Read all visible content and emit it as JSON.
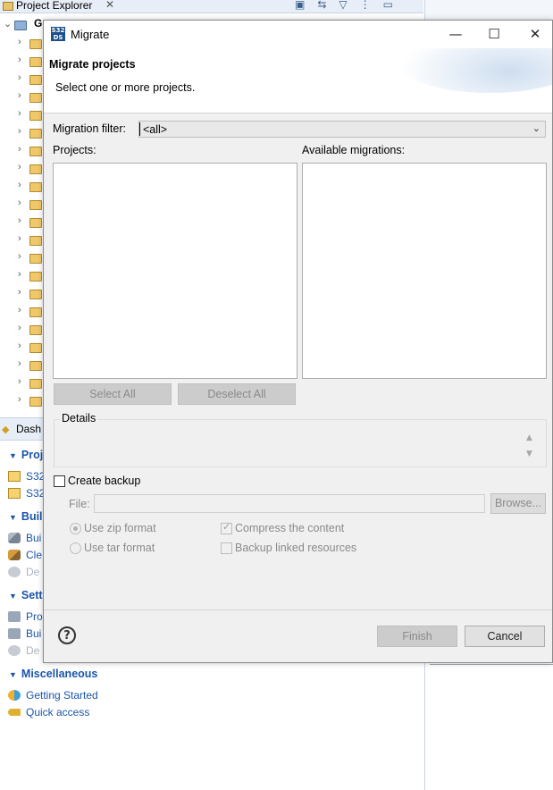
{
  "background": {
    "project_explorer": {
      "title": "Project Explorer",
      "close_glyph": "✕",
      "tool_icons": [
        "collapse-all-icon",
        "link-editor-icon",
        "filter-icon",
        "view-menu-icon",
        "minimize-icon"
      ],
      "root_label": "G",
      "folder_rows": 21
    },
    "dashboard": {
      "tab_label": "Dash",
      "sections": [
        {
          "label": "Proj",
          "items": [
            {
              "label": "S32",
              "icon": "new-project-icon",
              "disabled": false
            },
            {
              "label": "S32",
              "icon": "import-project-icon",
              "disabled": false
            }
          ]
        },
        {
          "label": "Buil",
          "items": [
            {
              "label": "Bui",
              "icon": "build-icon",
              "disabled": false
            },
            {
              "label": "Cle",
              "icon": "clean-icon",
              "disabled": false
            },
            {
              "label": "De",
              "icon": "debug-icon",
              "disabled": true
            }
          ]
        },
        {
          "label": "Sett",
          "items": [
            {
              "label": "Pro",
              "icon": "project-settings-icon",
              "disabled": false
            },
            {
              "label": "Bui",
              "icon": "build-settings-icon",
              "disabled": false
            },
            {
              "label": "De",
              "icon": "debug-settings-icon",
              "disabled": true
            }
          ]
        },
        {
          "label": "Miscellaneous",
          "items": [
            {
              "label": "Getting Started",
              "icon": "getting-started-icon",
              "disabled": false
            },
            {
              "label": "Quick access",
              "icon": "quick-access-icon",
              "disabled": false
            }
          ]
        }
      ]
    }
  },
  "dialog": {
    "window_title": "Migrate",
    "app_icon_text": "S32\nDS",
    "minimize_glyph": "—",
    "maximize_glyph": "☐",
    "close_glyph": "✕",
    "banner_title": "Migrate projects",
    "banner_message": "Select one or more projects.",
    "filter_label": "Migration filter:",
    "filter_value": "<all>",
    "projects_label": "Projects:",
    "migrations_label": "Available migrations:",
    "select_all": "Select All",
    "deselect_all": "Deselect All",
    "details_label": "Details",
    "create_backup_label": "Create backup",
    "create_backup_checked": false,
    "file_label": "File:",
    "file_value": "",
    "browse_label": "Browse...",
    "zip_label": "Use zip format",
    "tar_label": "Use tar format",
    "compress_label": "Compress the content",
    "compress_checked": true,
    "backup_linked_label": "Backup linked resources",
    "backup_linked_checked": false,
    "finish_label": "Finish",
    "cancel_label": "Cancel"
  }
}
